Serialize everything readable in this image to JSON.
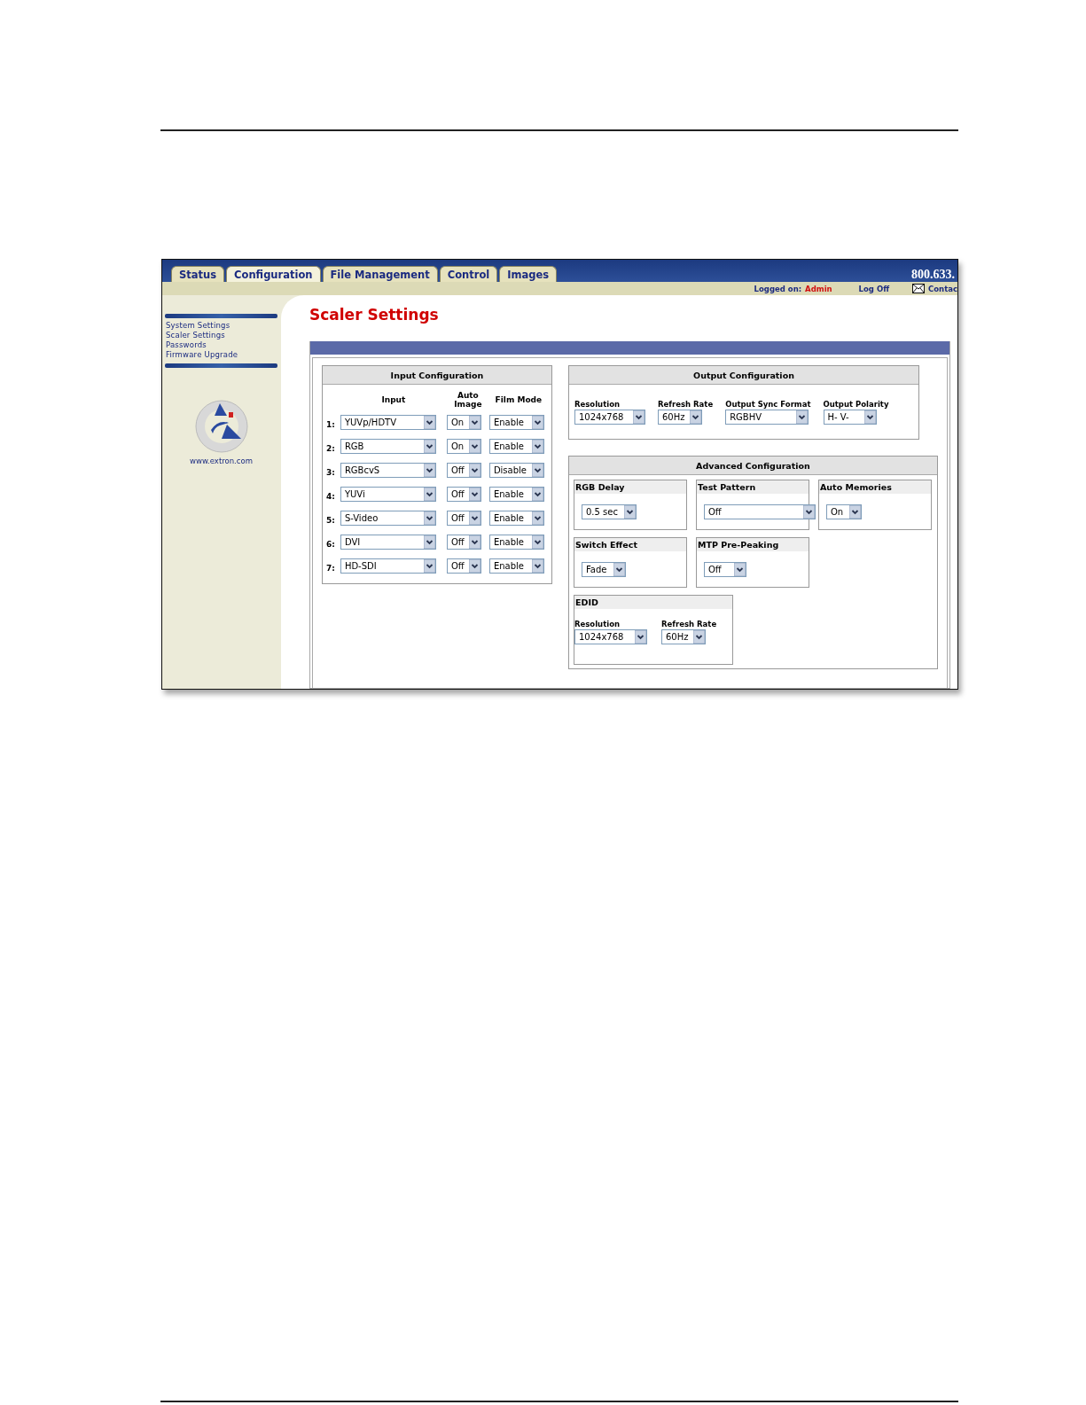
{
  "tabs": [
    {
      "label": "Status",
      "selected": false
    },
    {
      "label": "Configuration",
      "selected": true
    },
    {
      "label": "File Management",
      "selected": false
    },
    {
      "label": "Control",
      "selected": false
    },
    {
      "label": "Images",
      "selected": false
    }
  ],
  "phone": "800.633.",
  "account": {
    "logged_on_label": "Logged on:",
    "user": "Admin",
    "log_off": "Log Off",
    "contact": "Contac"
  },
  "sidebar": {
    "items": [
      "System Settings",
      "Scaler Settings",
      "Passwords",
      "Firmware Upgrade"
    ],
    "url": "www.extron.com"
  },
  "page_title": "Scaler Settings",
  "input_configuration": {
    "title": "Input Configuration",
    "columns": [
      "Input",
      "Auto Image",
      "Film Mode"
    ],
    "rows": [
      {
        "number": "1:",
        "input": "YUVp/HDTV",
        "auto_image": "On",
        "film_mode": "Enable"
      },
      {
        "number": "2:",
        "input": "RGB",
        "auto_image": "On",
        "film_mode": "Enable"
      },
      {
        "number": "3:",
        "input": "RGBcvS",
        "auto_image": "Off",
        "film_mode": "Disable"
      },
      {
        "number": "4:",
        "input": "YUVi",
        "auto_image": "Off",
        "film_mode": "Enable"
      },
      {
        "number": "5:",
        "input": "S-Video",
        "auto_image": "Off",
        "film_mode": "Enable"
      },
      {
        "number": "6:",
        "input": "DVI",
        "auto_image": "Off",
        "film_mode": "Enable"
      },
      {
        "number": "7:",
        "input": "HD-SDI",
        "auto_image": "Off",
        "film_mode": "Enable"
      }
    ]
  },
  "output_configuration": {
    "title": "Output Configuration",
    "fields": [
      {
        "label": "Resolution",
        "value": "1024x768"
      },
      {
        "label": "Refresh Rate",
        "value": "60Hz"
      },
      {
        "label": "Output Sync Format",
        "value": "RGBHV"
      },
      {
        "label": "Output Polarity",
        "value": "H- V-"
      }
    ]
  },
  "advanced_configuration": {
    "title": "Advanced Configuration",
    "groups": [
      {
        "title": "RGB Delay",
        "fields": [
          {
            "value": "0.5 sec"
          }
        ]
      },
      {
        "title": "Test Pattern",
        "fields": [
          {
            "value": "Off"
          }
        ]
      },
      {
        "title": "Auto Memories",
        "fields": [
          {
            "value": "On"
          }
        ]
      },
      {
        "title": "Switch Effect",
        "fields": [
          {
            "value": "Fade"
          }
        ]
      },
      {
        "title": "MTP Pre-Peaking",
        "fields": [
          {
            "value": "Off"
          }
        ]
      },
      {
        "title": "EDID",
        "fields": [
          {
            "label": "Resolution",
            "value": "1024x768"
          },
          {
            "label": "Refresh Rate",
            "value": "60Hz"
          }
        ]
      }
    ]
  }
}
